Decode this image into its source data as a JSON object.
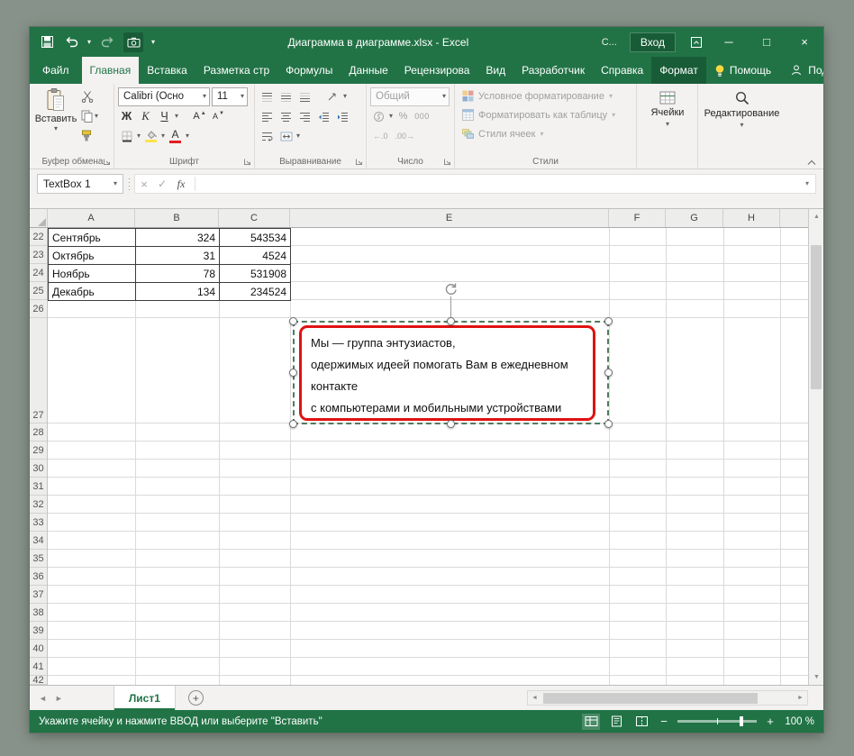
{
  "colors": {
    "excel_green": "#217346",
    "dark_green": "#185c37",
    "textbox_border": "#e01212"
  },
  "title_bar": {
    "title": "Диаграмма в диаграмме.xlsx - Excel",
    "account": "С...",
    "sign_in": "Вход",
    "minimize": "─",
    "maximize": "□",
    "close": "×"
  },
  "tabs": {
    "file": "Файл",
    "items": [
      "Главная",
      "Вставка",
      "Разметка стр",
      "Формулы",
      "Данные",
      "Рецензирова",
      "Вид",
      "Разработчик",
      "Справка",
      "Формат"
    ],
    "help": "Помощь",
    "share": "Поделиться"
  },
  "ribbon": {
    "clipboard": {
      "label": "Буфер обмена",
      "paste": "Вставить"
    },
    "font": {
      "label": "Шрифт",
      "name": "Calibri (Осно",
      "size": "11",
      "bold": "Ж",
      "italic": "К",
      "underline": "Ч"
    },
    "alignment": {
      "label": "Выравнивание"
    },
    "number": {
      "label": "Число",
      "format": "Общий",
      "percent": "%",
      "thousands": "000"
    },
    "styles": {
      "label": "Стили",
      "conditional": "Условное форматирование",
      "as_table": "Форматировать как таблицу",
      "cell_styles": "Стили ячеек"
    },
    "cells": {
      "label": "Ячейки"
    },
    "editing": {
      "label": "Редактирование"
    }
  },
  "formula_bar": {
    "name_box": "TextBox 1",
    "cancel": "×",
    "enter": "✓",
    "fx": "fx",
    "value": ""
  },
  "sheet": {
    "col_headers": [
      "A",
      "B",
      "C",
      "E",
      "F",
      "G",
      "H"
    ],
    "row_headers": [
      "22",
      "23",
      "24",
      "25",
      "26",
      "27",
      "28",
      "29",
      "30",
      "31",
      "32",
      "33",
      "34",
      "35",
      "36",
      "37",
      "38",
      "39",
      "40",
      "41",
      "42"
    ],
    "data": {
      "r22": {
        "a": "Сентябрь",
        "b": "324",
        "c": "543534"
      },
      "r23": {
        "a": "Октябрь",
        "b": "31",
        "c": "4524"
      },
      "r24": {
        "a": "Ноябрь",
        "b": "78",
        "c": "531908"
      },
      "r25": {
        "a": "Декабрь",
        "b": "134",
        "c": "234524"
      }
    }
  },
  "textbox": {
    "line1": "Мы — группа энтузиастов,",
    "line2": "одержимых идеей помогать Вам в ежедневном",
    "line3": "контакте",
    "line4": "с компьютерами и мобильными устройствами"
  },
  "sheet_tabs": {
    "active": "Лист1",
    "add": "+"
  },
  "status_bar": {
    "message": "Укажите ячейку и нажмите ВВОД или выберите \"Вставить\"",
    "zoom_out": "−",
    "zoom_in": "+",
    "zoom_level": "100 %"
  },
  "icons": {
    "dropdown": "▾",
    "letter_a": "А",
    "tri_up": "▲",
    "tri_down": "▼",
    "up_arrow": "▲",
    "down_arrow": "▼",
    "left_arrow": "◄",
    "right_arrow": "►",
    "dec_increase": "←.0",
    "dec_decrease": ".00→"
  }
}
